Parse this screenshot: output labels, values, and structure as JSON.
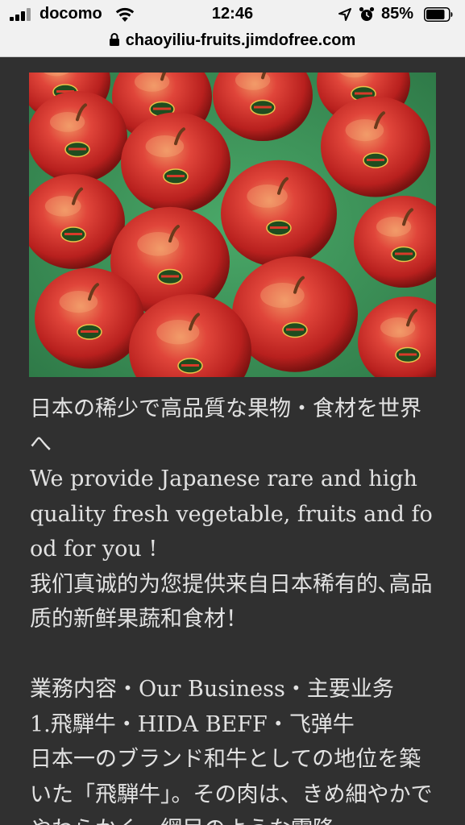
{
  "status_bar": {
    "carrier": "docomo",
    "time": "12:46",
    "battery_percent": "85%",
    "battery_level": 0.85,
    "icons": [
      "signal-icon",
      "wifi-icon",
      "location-icon",
      "alarm-icon",
      "battery-icon"
    ]
  },
  "url_bar": {
    "url": "chaoyiliu-fruits.jimdofree.com",
    "icon": "lock-icon"
  },
  "hero": {
    "description_icon": "apples-image"
  },
  "content": {
    "intro_ja": "日本の稀少で高品質な果物・食材を世界へ",
    "intro_en": "We provide Japanese rare and high quality fresh vegetable, fruits and food for you !",
    "intro_zh": "我们真诚的为您提供来自日本稀有的､高品质的新鲜果蔬和食材！",
    "business_heading": "業務内容・Our Business・主要业务",
    "item1_title": "1.飛騨牛・HIDA BEFF・飞弹牛",
    "item1_text": "日本一のブランド和牛としての地位を築いた「飛騨牛」。その肉は、きめ細やかでやわらかく、網目のような霜降"
  },
  "colors": {
    "page_background": "#303030",
    "text": "#e2e2e2",
    "status_bar_background": "#f1f1f1"
  }
}
